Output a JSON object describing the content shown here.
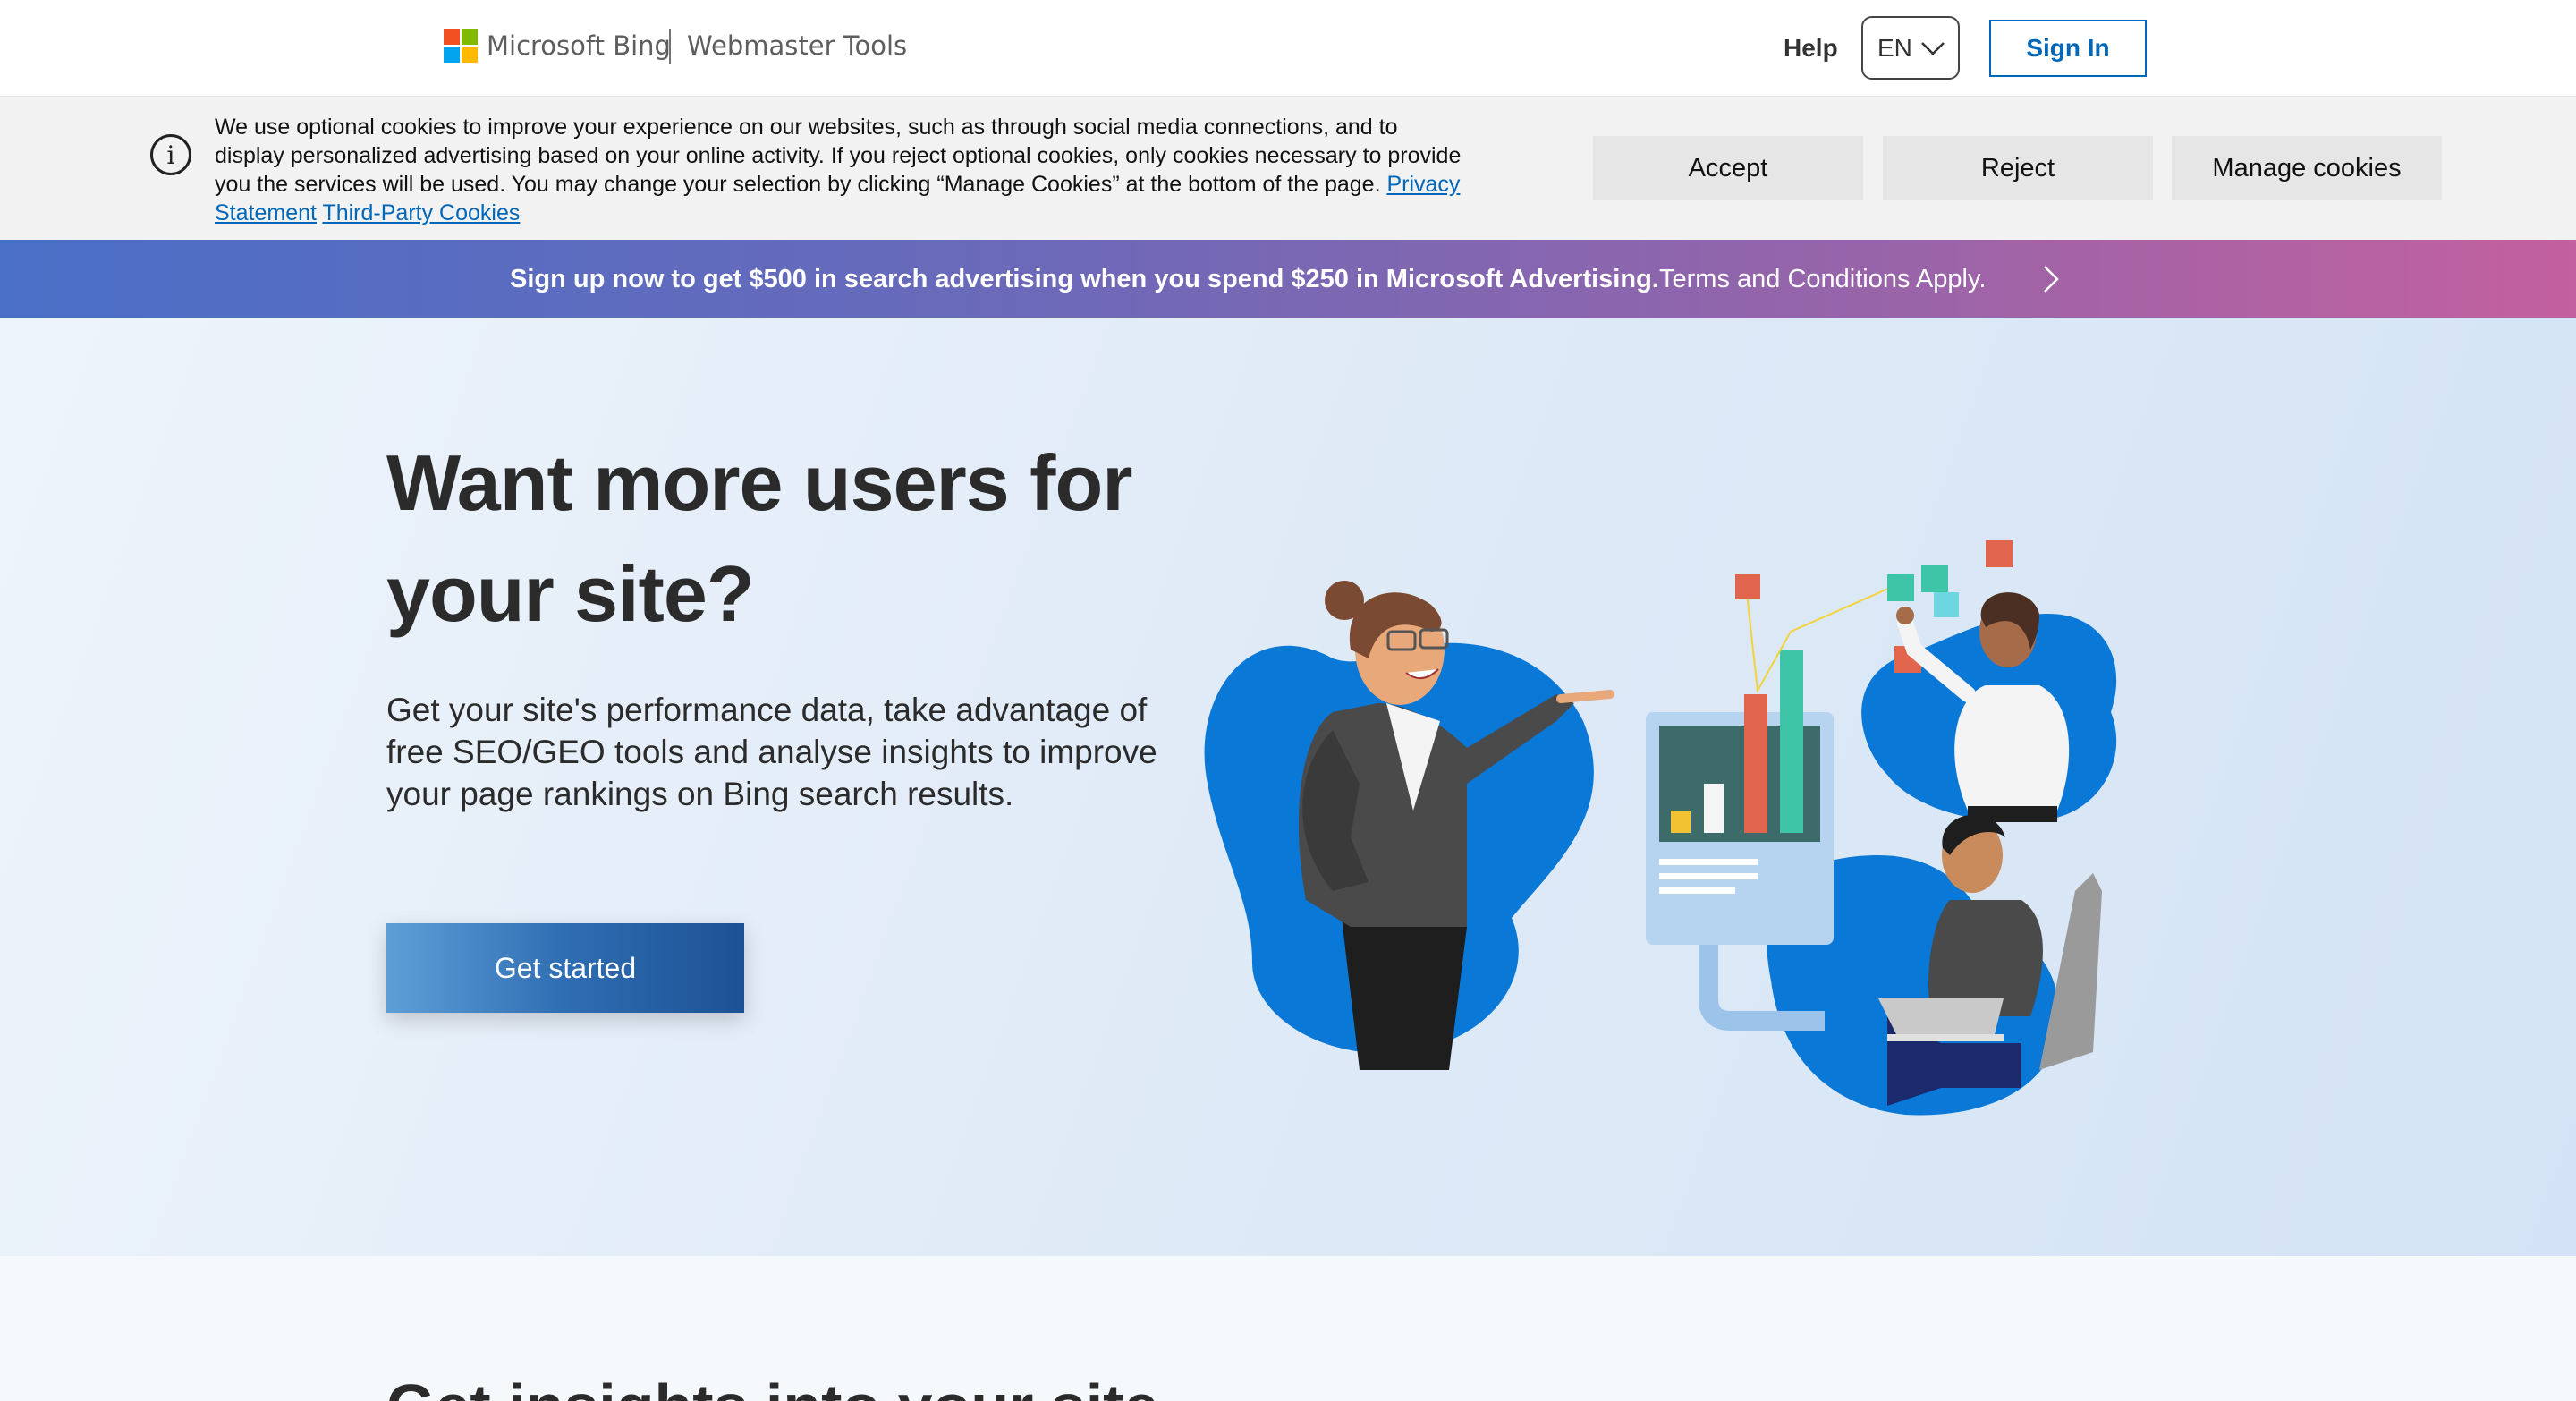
{
  "header": {
    "brand": "Microsoft Bing",
    "product": "Webmaster Tools",
    "help": "Help",
    "language": "EN",
    "sign_in": "Sign In",
    "logo_colors": [
      "#f25022",
      "#7fba00",
      "#00a4ef",
      "#ffb900"
    ]
  },
  "cookie_banner": {
    "text": "We use optional cookies to improve your experience on our websites, such as through social media connections, and to display personalized advertising based on your online activity. If you reject optional cookies, only cookies necessary to provide you the services will be used. You may change your selection by clicking “Manage Cookies” at the bottom of the page.",
    "privacy_link": "Privacy Statement",
    "third_party_link": "Third-Party Cookies",
    "accept": "Accept",
    "reject": "Reject",
    "manage": "Manage cookies"
  },
  "promo": {
    "main": "Sign up now to get $500 in search advertising when you spend $250 in Microsoft Advertising.",
    "terms": "Terms and Conditions Apply."
  },
  "hero": {
    "title": "Want more users for your site?",
    "subtitle": "Get your site's performance data, take advantage of free SEO/GEO tools and analyse insights to improve your page rankings on Bing search results.",
    "cta": "Get started"
  },
  "next_section": {
    "title": "Get insights into your site"
  },
  "colors": {
    "accent": "#0067b8",
    "blob_blue": "#0a78d7"
  }
}
